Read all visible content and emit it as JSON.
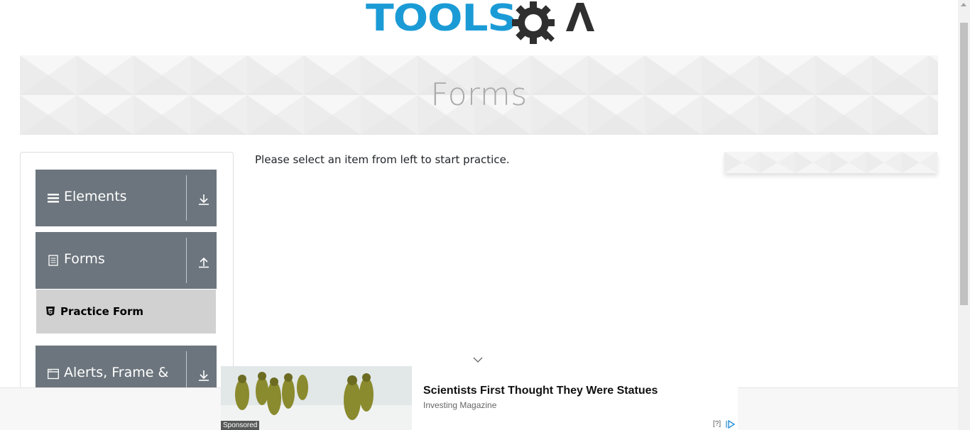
{
  "header": {
    "logo_text_left": "TOOLS",
    "logo_text_right": "QA"
  },
  "banner": {
    "title": "Forms"
  },
  "sidebar": {
    "groups": [
      {
        "label": "Elements",
        "icon": "list-icon",
        "toggle": "download-icon"
      },
      {
        "label": "Forms",
        "icon": "document-icon",
        "toggle": "upload-icon",
        "expanded": true,
        "items": [
          {
            "label": "Practice Form",
            "icon": "html5-icon"
          }
        ]
      },
      {
        "label": "Alerts, Frame &",
        "icon": "window-icon",
        "toggle": "download-icon"
      }
    ]
  },
  "main": {
    "message": "Please select an item from left to start practice."
  },
  "ad": {
    "sponsored_label": "Sponsored",
    "headline": "Scientists First Thought They Were Statues",
    "source": "Investing Magazine",
    "info_label": "[?]"
  },
  "colors": {
    "brand_blue": "#1b9bd6",
    "logo_dark": "#2f2f2f",
    "group_bg": "#6c757d",
    "item_active_bg": "#d1d1d1"
  }
}
